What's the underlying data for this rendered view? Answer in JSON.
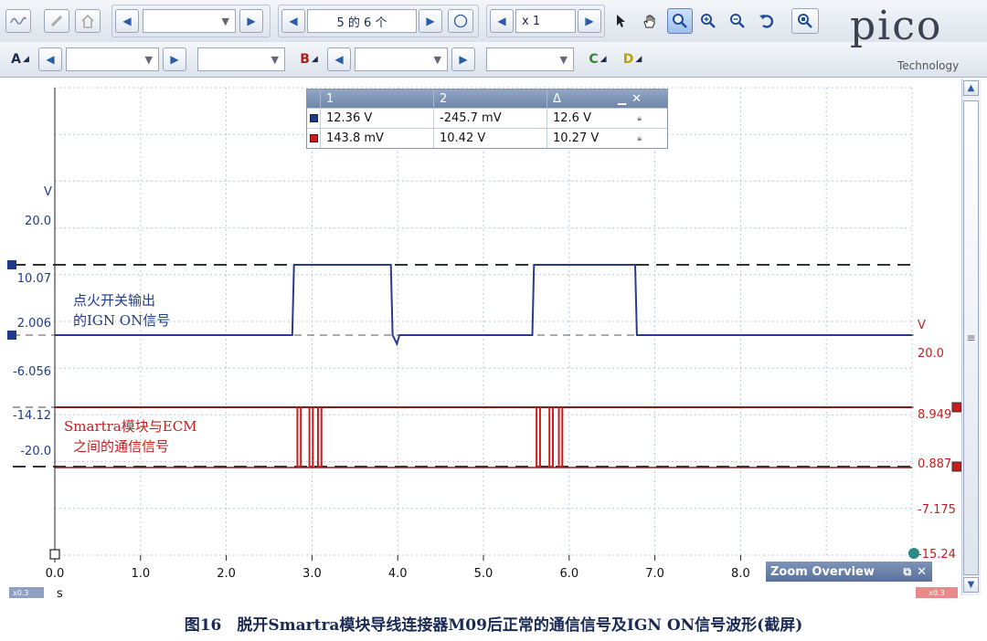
{
  "toolbar": {
    "page_indicator": "5 的 6 个",
    "zoom_factor": "x 1",
    "channel_a": "A",
    "channel_b": "B",
    "channel_c": "C",
    "channel_d": "D",
    "colors": {
      "channel_a": "#2b3a8f",
      "channel_b": "#c41e1e"
    }
  },
  "brand": {
    "logo": "pico",
    "tagline": "Technology"
  },
  "measurements": {
    "headers": [
      "1",
      "2",
      "Δ"
    ],
    "rows": [
      {
        "channel": "A",
        "color": "#1f3b8c",
        "v1": "12.36 V",
        "v2": "-245.7 mV",
        "delta": "12.6 V"
      },
      {
        "channel": "B",
        "color": "#c41e1e",
        "v1": "143.8 mV",
        "v2": "10.42 V",
        "delta": "10.27 V"
      }
    ]
  },
  "annotations": {
    "ign_line1": "点火开关输出",
    "ign_line2": "的IGN ON信号",
    "comm_line1": "Smartra模块与ECM",
    "comm_line2": "之间的通信信号"
  },
  "overlay": {
    "zoom_overview": "Zoom Overview",
    "mini_left": "x0.3",
    "mini_right": "x0.3"
  },
  "caption": "图16　脱开Smartra模块导线连接器M09后正常的通信信号及IGN ON信号波形(截屏)",
  "chart_data": {
    "type": "line",
    "x_unit": "s",
    "x_ticks": [
      "0.0",
      "1.0",
      "2.0",
      "3.0",
      "4.0",
      "5.0",
      "6.0",
      "7.0",
      "8.0"
    ],
    "xlim": [
      0,
      10
    ],
    "left_axis": {
      "unit": "V",
      "ticks": [
        "20.0",
        "10.07",
        "2.006",
        "-6.056",
        "-14.12",
        "-20.0"
      ]
    },
    "right_axis": {
      "unit": "V",
      "ticks": [
        "20.0",
        "8.949",
        "0.887",
        "-7.175",
        "-15.24"
      ]
    },
    "rulers": {
      "blue_upper": 10.07,
      "blue_lower": 2.006,
      "red_upper": 8.949,
      "red_lower": 0.887
    },
    "series": [
      {
        "channel": "A",
        "color": "#2b3a8f",
        "axis": "left",
        "x": [
          0,
          2.77,
          2.79,
          3.92,
          3.94,
          3.99,
          4.02,
          5.57,
          5.59,
          6.77,
          6.79,
          10
        ],
        "y": [
          2.006,
          2.006,
          10.07,
          10.07,
          2.006,
          1.0,
          2.006,
          2.006,
          10.07,
          10.07,
          2.006,
          2.006
        ]
      },
      {
        "channel": "B",
        "color": "#c41e1e",
        "axis": "right",
        "pulses": [
          [
            2.83,
            2.87
          ],
          [
            2.97,
            3.01
          ],
          [
            3.07,
            3.11
          ],
          [
            5.62,
            5.66
          ],
          [
            5.77,
            5.81
          ],
          [
            5.88,
            5.92
          ]
        ],
        "high": 8.949,
        "low": 0.887
      }
    ]
  }
}
